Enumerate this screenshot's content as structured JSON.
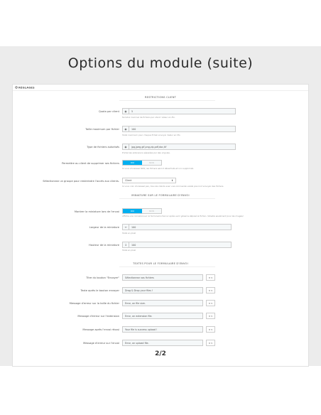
{
  "page_title": "Options du module (suite)",
  "panel_header": "RÉGLAGES",
  "sections": {
    "restrictions": "RESTRICTIONS CLIENT",
    "miniature": "MINIATURE SUR LE FORMULAIRE D'ENVOI",
    "textes": "TEXTES POUR LE FORMULAIRE D'ENVOI"
  },
  "fields": {
    "quota": {
      "label": "Quota par client",
      "value": "5",
      "help": "Nombre maximal de fichiers par client. Valeur en Mo."
    },
    "taille_max": {
      "label": "Taille maximum par fichier",
      "value": "100",
      "help": "Taille maximum pour chaque fichier envoyé. Valeur en Mo."
    },
    "types": {
      "label": "Type de fichiers autorisés",
      "value": "jpg,jpeg,gif,png,zip,pdf,doc,tif",
      "help": "Entrez les extensions séparées par des virgules."
    },
    "suppression": {
      "label": "Permettre au client de supprimer ses fichiers",
      "on": "OUI",
      "off": "NON",
      "help": "Si vous choisissez NON, les fichiers seront désactivés et non supprimés."
    },
    "groupe": {
      "label": "Sélectionnez un groupe pour restreindre l'accès aux clients.",
      "value": "Client",
      "help": "Si vous n'en choisissez pas, tous les clients avec une commande valide pourront envoyer des fichiers."
    },
    "miniature": {
      "label": "Montrer la miniature lors de l'envoi",
      "on": "OUI",
      "off": "NON",
      "help": "Affiche une miniature sur le formulaire d'envoi après avoir glissé & déposé le fichier. (Valable seulement pour les images)"
    },
    "largeur": {
      "label": "Largeur de la miniature",
      "value": "100",
      "help": "Taille en pixel"
    },
    "hauteur": {
      "label": "Hauteur de la miniature",
      "value": "100",
      "help": "Taille en pixel"
    }
  },
  "textes": [
    {
      "label": "Titre du bouton \"Envoyer\"",
      "value": "Sélectionnez vos fichiers",
      "lang": "fr"
    },
    {
      "label": "Texte après le bouton envoyer",
      "value": "Drag & Drop your files !",
      "lang": "fr"
    },
    {
      "label": "Message d'erreur sur la taille du fichier",
      "value": "Error, on file size.",
      "lang": "fr"
    },
    {
      "label": "Message d'erreur sur l'extension",
      "value": "Error, on extension file.",
      "lang": "fr"
    },
    {
      "label": "Message après l'envoi réussi",
      "value": "Your file is success upload !",
      "lang": "fr"
    },
    {
      "label": "Message d'erreur sur l'envoi",
      "value": "Error, on upload file.",
      "lang": "fr"
    }
  ],
  "pager": "2/2",
  "colors": {
    "accent": "#00aff0",
    "band": "#ececec"
  },
  "icons": {
    "header": "gear-icon",
    "quota": "target-icon",
    "taille": "target-icon",
    "types": "target-icon",
    "largeur": "width-arrows-icon",
    "hauteur": "height-arrows-icon"
  }
}
